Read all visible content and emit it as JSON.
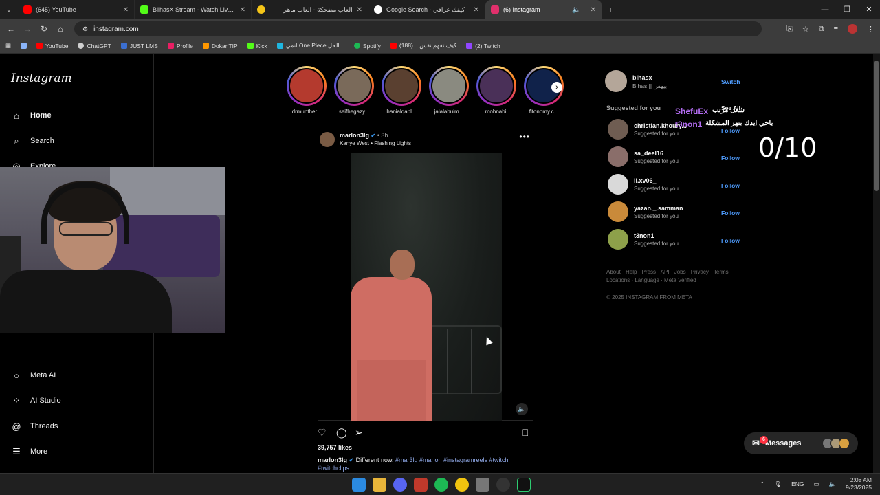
{
  "browser": {
    "tabs": [
      {
        "title": "(645) YouTube",
        "color": "#ff0000",
        "active": false
      },
      {
        "title": "BiihasX Stream - Watch Live on",
        "color": "#53fc18",
        "active": false
      },
      {
        "title": "العاب مضحكة - العاب ماهر",
        "color": "#f5c518",
        "active": false
      },
      {
        "title": "Google Search - كيفك عراقي",
        "color": "#ffffff",
        "active": false
      },
      {
        "title": "(6) Instagram",
        "color": "#e1306c",
        "active": true
      }
    ],
    "url": "instagram.com",
    "bookmarks": [
      {
        "label": "YouTube",
        "color": "#ff0000"
      },
      {
        "label": "ChatGPT",
        "color": "#cfcfcf"
      },
      {
        "label": "JUST LMS",
        "color": "#3b6fd1"
      },
      {
        "label": "Profile",
        "color": "#e91e63"
      },
      {
        "label": "DokanTIP",
        "color": "#ff9800"
      },
      {
        "label": "Kick",
        "color": "#53fc18"
      },
      {
        "label": "انمي One Piece الحل...",
        "color": "#1fb6e0"
      },
      {
        "label": "Spotify",
        "color": "#1db954"
      },
      {
        "label": "كيف تفهم نفس... (188)",
        "color": "#ff0000"
      },
      {
        "label": "(2) Twitch",
        "color": "#9146ff"
      }
    ]
  },
  "sidebar": {
    "logo": "Instagram",
    "items": [
      {
        "label": "Home",
        "icon": "home-icon"
      },
      {
        "label": "Search",
        "icon": "search-icon"
      },
      {
        "label": "Explore",
        "icon": "explore-icon"
      },
      {
        "label": "Meta AI",
        "icon": "meta-ai-icon"
      },
      {
        "label": "AI Studio",
        "icon": "ai-studio-icon"
      },
      {
        "label": "Threads",
        "icon": "threads-icon"
      },
      {
        "label": "More",
        "icon": "menu-icon"
      }
    ]
  },
  "stories": [
    {
      "name": "drmunther...",
      "color": "#b43a2e"
    },
    {
      "name": "seifhegazy...",
      "color": "#7a6a5a"
    },
    {
      "name": "hanialqabl...",
      "color": "#5a4030"
    },
    {
      "name": "jalalabuim...",
      "color": "#8a8a80"
    },
    {
      "name": "mohnabil",
      "color": "#4a3058"
    },
    {
      "name": "fitonomy.c...",
      "color": "#10224a"
    }
  ],
  "post": {
    "user": "marlon3lg",
    "time": "3h",
    "song": "Kanye West • Flashing Lights",
    "likes": "39,757 likes",
    "caption_user": "marlon3lg",
    "caption_text": "Different now.",
    "caption_tags": "#mar3lg #marlon #instagramreels #twitch #twitchclips"
  },
  "right": {
    "me_user": "bihasx",
    "me_name": "Bihas || بيهس",
    "switch": "Switch",
    "suggested_title": "Suggested for you",
    "see_all": "See All",
    "suggestions": [
      {
        "user": "christian.khoury...",
        "sub": "Suggested for you",
        "action": "Follow",
        "color": "#6f5d52"
      },
      {
        "user": "sa_deel16",
        "sub": "Suggested for you",
        "action": "Follow",
        "color": "#8a6e6a"
      },
      {
        "user": "ll.xv06_",
        "sub": "Suggested for you",
        "action": "Follow",
        "color": "#d9d9d9"
      },
      {
        "user": "yazan._.samman",
        "sub": "Suggested for you",
        "action": "Follow",
        "color": "#c98a3a"
      },
      {
        "user": "t3non1",
        "sub": "Suggested for you",
        "action": "Follow",
        "color": "#8da04a"
      }
    ],
    "footer": "About · Help · Press · API · Jobs · Privacy · Terms · Locations · Language · Meta Verified",
    "copyright": "© 2025 INSTAGRAM FROM META"
  },
  "overlay": {
    "name1": "ShefuEx",
    "text1": "شغل مرتب",
    "name2": "t3non1",
    "text2": "ياخي ايدك بتهز المشكلة",
    "score": "0/10"
  },
  "messages": {
    "label": "Messages",
    "badge": "6"
  },
  "taskbar": {
    "lang": "ENG",
    "time": "2:08 AM",
    "date": "9/23/2025"
  }
}
